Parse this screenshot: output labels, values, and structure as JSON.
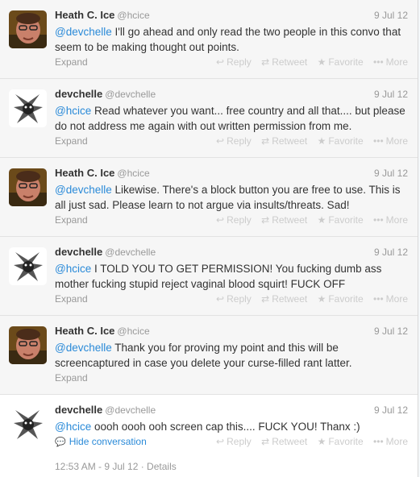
{
  "actions": {
    "reply": "Reply",
    "retweet": "Retweet",
    "favorite": "Favorite",
    "more": "More"
  },
  "tweets": [
    {
      "name": "Heath C. Ice",
      "handle": "@hcice",
      "time": "9 Jul 12",
      "mention": "@devchelle",
      "text": " I'll go ahead and only read the two people in this convo that seem to be making thought out points.",
      "expand": "Expand"
    },
    {
      "name": "devchelle",
      "handle": "@devchelle",
      "time": "9 Jul 12",
      "mention": "@hcice",
      "text": " Read whatever you want... free country and all that.... but please do not address me again with out written permission from me.",
      "expand": "Expand"
    },
    {
      "name": "Heath C. Ice",
      "handle": "@hcice",
      "time": "9 Jul 12",
      "mention": "@devchelle",
      "text": " Likewise. There's a block button you are free to use. This is all just sad. Please learn to not argue via insults/threats.  Sad!",
      "expand": "Expand"
    },
    {
      "name": "devchelle",
      "handle": "@devchelle",
      "time": "9 Jul 12",
      "mention": "@hcice",
      "text": " I TOLD YOU TO GET PERMISSION! You fucking dumb ass mother fucking stupid reject vaginal blood squirt! FUCK OFF",
      "expand": "Expand"
    },
    {
      "name": "Heath C. Ice",
      "handle": "@hcice",
      "time": "9 Jul 12",
      "mention": "@devchelle",
      "text": " Thank you for proving my point and this will be screencaptured in case you delete your curse-filled rant latter.",
      "expand": "Expand"
    },
    {
      "name": "devchelle",
      "handle": "@devchelle",
      "time": "9 Jul 12",
      "mention": "@hcice",
      "text": " oooh oooh ooh screen cap this.... FUCK YOU! Thanx :)",
      "hide": "Hide conversation",
      "meta": "12:53 AM - 9 Jul 12 · Details"
    }
  ]
}
